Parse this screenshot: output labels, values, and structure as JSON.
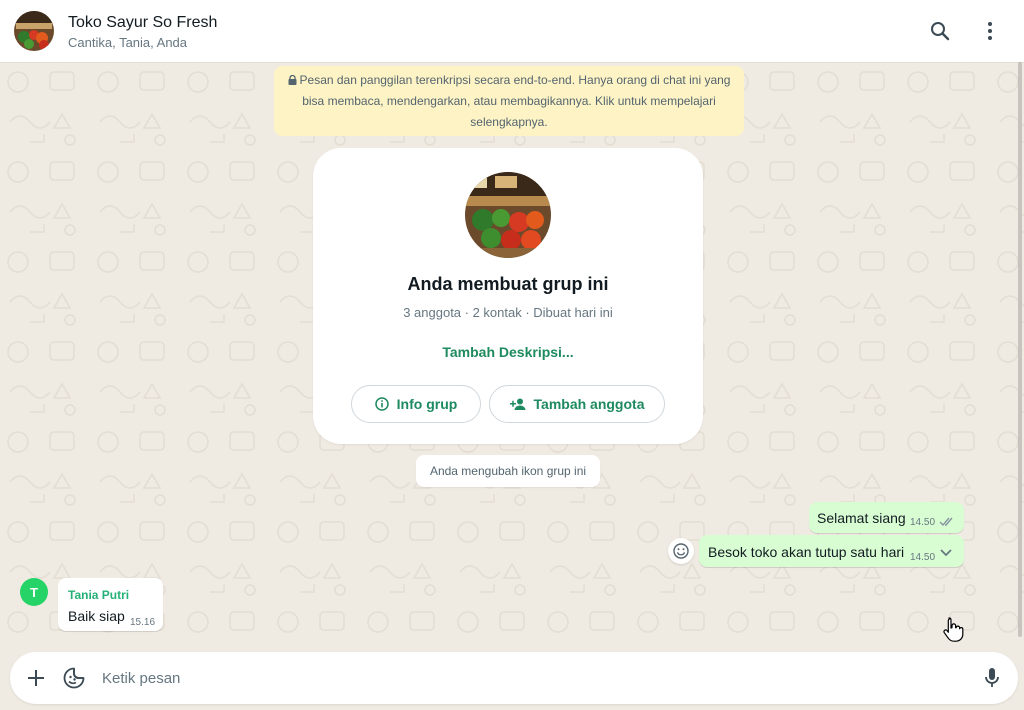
{
  "header": {
    "title": "Toko Sayur So Fresh",
    "members": "Cantika, Tania, Anda",
    "search_icon": "search-icon",
    "menu_icon": "kebab-menu-icon"
  },
  "encryption_notice": "Pesan dan panggilan terenkripsi secara end-to-end. Hanya orang di chat ini yang bisa membaca, mendengarkan, atau membagikannya. Klik untuk mempelajari selengkapnya.",
  "group_card": {
    "title": "Anda membuat grup ini",
    "meta": "3 anggota · 2 kontak · Dibuat hari ini",
    "add_description": "Tambah Deskripsi...",
    "info_button": "Info grup",
    "add_member_button": "Tambah anggota"
  },
  "system_note": "Anda mengubah ikon grup ini",
  "messages": [
    {
      "direction": "out",
      "text": "Selamat siang",
      "time": "14.50",
      "status": "read"
    },
    {
      "direction": "out",
      "text": "Besok toko akan tutup satu hari",
      "time": "14.50",
      "status": "delivered"
    },
    {
      "direction": "in",
      "sender": "Tania Putri",
      "sender_initial": "T",
      "text": "Baik siap",
      "time": "15.16"
    }
  ],
  "composer": {
    "placeholder": "Ketik pesan",
    "attach_icon": "plus-icon",
    "sticker_icon": "sticker-icon",
    "mic_icon": "microphone-icon"
  },
  "colors": {
    "accent_green": "#1e8a5f",
    "outgoing_bubble": "#d9fdd3",
    "chat_background": "#efeae2",
    "notice_background": "#fdf3c5",
    "sender_name": "#25b077"
  }
}
